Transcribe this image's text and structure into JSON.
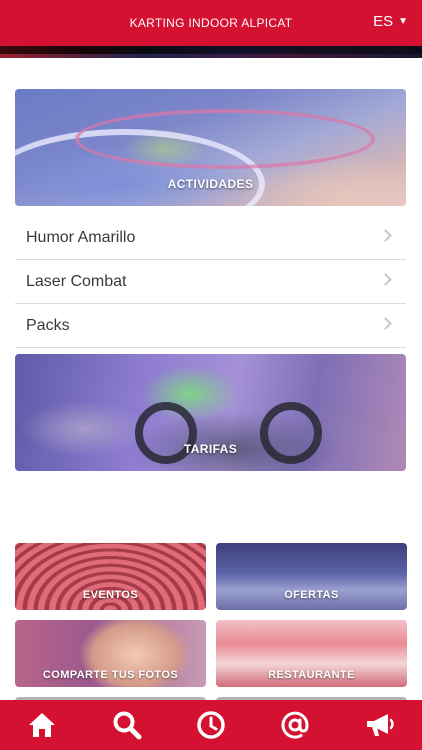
{
  "header": {
    "title": "KARTING INDOOR ALPICAT",
    "language": "ES"
  },
  "cards": {
    "activities": {
      "label": "ACTIVIDADES"
    },
    "rates": {
      "label": "TARIFAS"
    }
  },
  "menu": {
    "items": [
      {
        "label": "Humor Amarillo"
      },
      {
        "label": "Laser Combat"
      },
      {
        "label": "Packs"
      }
    ]
  },
  "tiles": [
    {
      "label": "EVENTOS"
    },
    {
      "label": "OFERTAS"
    },
    {
      "label": "COMPARTE TUS FOTOS"
    },
    {
      "label": "RESTAURANTE"
    }
  ],
  "bottom_nav": [
    {
      "icon": "home-icon"
    },
    {
      "icon": "search-icon"
    },
    {
      "icon": "clock-icon"
    },
    {
      "icon": "at-icon"
    },
    {
      "icon": "megaphone-icon"
    }
  ],
  "colors": {
    "brand": "#d41130",
    "text": "#3a3a3a",
    "divider": "#dcdcdc"
  }
}
